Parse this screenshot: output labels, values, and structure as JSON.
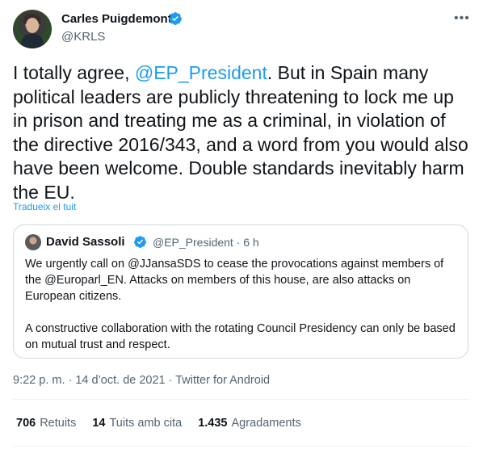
{
  "author": {
    "name": "Carles Puigdemont",
    "handle": "@KRLS"
  },
  "more_label": "•••",
  "tweet": {
    "text_before": "I totally agree, ",
    "mention": "@EP_President",
    "text_after": ". But in Spain many political leaders are publicly threatening to lock me up in prison and treating me as a criminal, in violation of the directive 2016/343, and a word from you would also have been welcome. Double standards inevitably harm the EU.",
    "translate_label": "Tradueix el tuit"
  },
  "quote": {
    "name": "David Sassoli",
    "handle_time": "@EP_President · 6 h",
    "paragraph1": "We urgently call on @JJansaSDS to cease the provocations against members of the @Europarl_EN. Attacks on members of this house, are also attacks on European citizens.",
    "paragraph2": "A constructive collaboration with the rotating Council Presidency can only be based on mutual trust and respect."
  },
  "meta": "9:22 p. m. · 14 d’oct. de 2021 · Twitter for Android",
  "stats": [
    {
      "count": "706",
      "label": "Retuits"
    },
    {
      "count": "14",
      "label": "Tuits amb cita"
    },
    {
      "count": "1.435",
      "label": "Agradaments"
    }
  ],
  "colors": {
    "accent": "#1d9bf0",
    "secondary_text": "#536471",
    "border": "#cfd9de"
  }
}
